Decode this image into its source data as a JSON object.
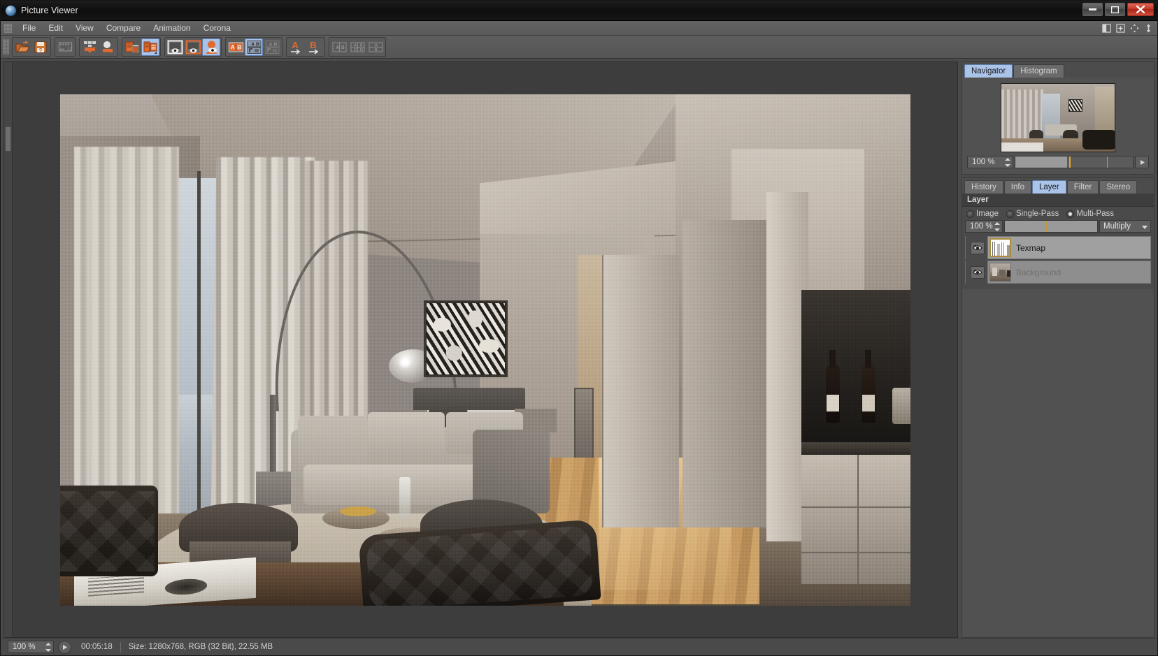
{
  "window": {
    "title": "Picture Viewer",
    "icon": "app-sphere-icon",
    "minimize_label": "–",
    "maximize_label": "❐",
    "close_label": "✕"
  },
  "menubar": {
    "items": [
      {
        "label": "File"
      },
      {
        "label": "Edit"
      },
      {
        "label": "View"
      },
      {
        "label": "Compare"
      },
      {
        "label": "Animation"
      },
      {
        "label": "Corona"
      }
    ],
    "right_icons": [
      "split-layout-icon",
      "add-panel-icon",
      "move-icon",
      "resize-vertical-icon"
    ]
  },
  "toolbar": {
    "groups": [
      {
        "buttons": [
          {
            "name": "open-file-icon",
            "selected": false
          },
          {
            "name": "save-file-icon",
            "selected": false
          }
        ]
      },
      {
        "buttons": [
          {
            "name": "filmstrip-icon",
            "selected": false
          }
        ]
      },
      {
        "buttons": [
          {
            "name": "load-frames-icon",
            "selected": false
          },
          {
            "name": "load-object-icon",
            "selected": false
          }
        ]
      },
      {
        "buttons": [
          {
            "name": "delete-frames-icon",
            "selected": false
          },
          {
            "name": "keep-frames-icon",
            "selected": true
          }
        ]
      },
      {
        "buttons": [
          {
            "name": "view-a-icon",
            "selected": false
          },
          {
            "name": "view-b-icon",
            "selected": false
          },
          {
            "name": "view-ab-icon",
            "selected": true
          }
        ]
      },
      {
        "buttons": [
          {
            "name": "compare-ab-icon",
            "selected": false
          },
          {
            "name": "compare-ab-swap-icon",
            "selected": true
          },
          {
            "name": "compare-ab-disabled-icon",
            "selected": false
          }
        ]
      },
      {
        "buttons": [
          {
            "name": "set-a-icon",
            "selected": false
          },
          {
            "name": "set-b-icon",
            "selected": false
          }
        ]
      },
      {
        "buttons": [
          {
            "name": "layout-ab-icon",
            "selected": false
          },
          {
            "name": "layout-grid-icon",
            "selected": false
          },
          {
            "name": "layout-stack-icon",
            "selected": false
          }
        ]
      }
    ]
  },
  "navigator": {
    "tabs": [
      {
        "label": "Navigator",
        "active": true
      },
      {
        "label": "Histogram",
        "active": false
      }
    ],
    "zoom_value": "100 %",
    "slider_fill_percent": 44,
    "slider_mark_percent": 46,
    "slider_secondary_mark_percent": 78,
    "play_button": "play-icon"
  },
  "layer_panel": {
    "tabs": [
      {
        "label": "History",
        "active": false
      },
      {
        "label": "Info",
        "active": false
      },
      {
        "label": "Layer",
        "active": true
      },
      {
        "label": "Filter",
        "active": false
      },
      {
        "label": "Stereo",
        "active": false
      }
    ],
    "section_title": "Layer",
    "modes": [
      {
        "label": "Image",
        "selected": false
      },
      {
        "label": "Single-Pass",
        "selected": false
      },
      {
        "label": "Multi-Pass",
        "selected": true
      }
    ],
    "opacity_value": "100 %",
    "opacity_fill_percent": 100,
    "opacity_mark_percent": 45,
    "blend_mode": "Multiply",
    "layers": [
      {
        "name": "Texmap",
        "visible": true,
        "selected": true,
        "thumb": "texmap-thumb"
      },
      {
        "name": "Background",
        "visible": true,
        "selected": false,
        "thumb": "background-thumb"
      }
    ]
  },
  "statusbar": {
    "zoom_value": "100 %",
    "play_button": "play-icon",
    "time": "00:05:18",
    "info": "Size: 1280x768, RGB (32 Bit), 22.55 MB"
  },
  "colors": {
    "accent_orange": "#e06a30",
    "selection_blue": "#a9c3e9",
    "marker_yellow": "#e8a720",
    "panel_bg": "#4a4a4a",
    "close_red": "#c4392a"
  },
  "image": {
    "alt": "Rendered interior visualization of a modern apartment living room with floor-to-ceiling curtains, arc floor lamp, abstract artwork, grey sofa, leather tub chairs, wooden floor and dark kitchen cabinetry"
  }
}
